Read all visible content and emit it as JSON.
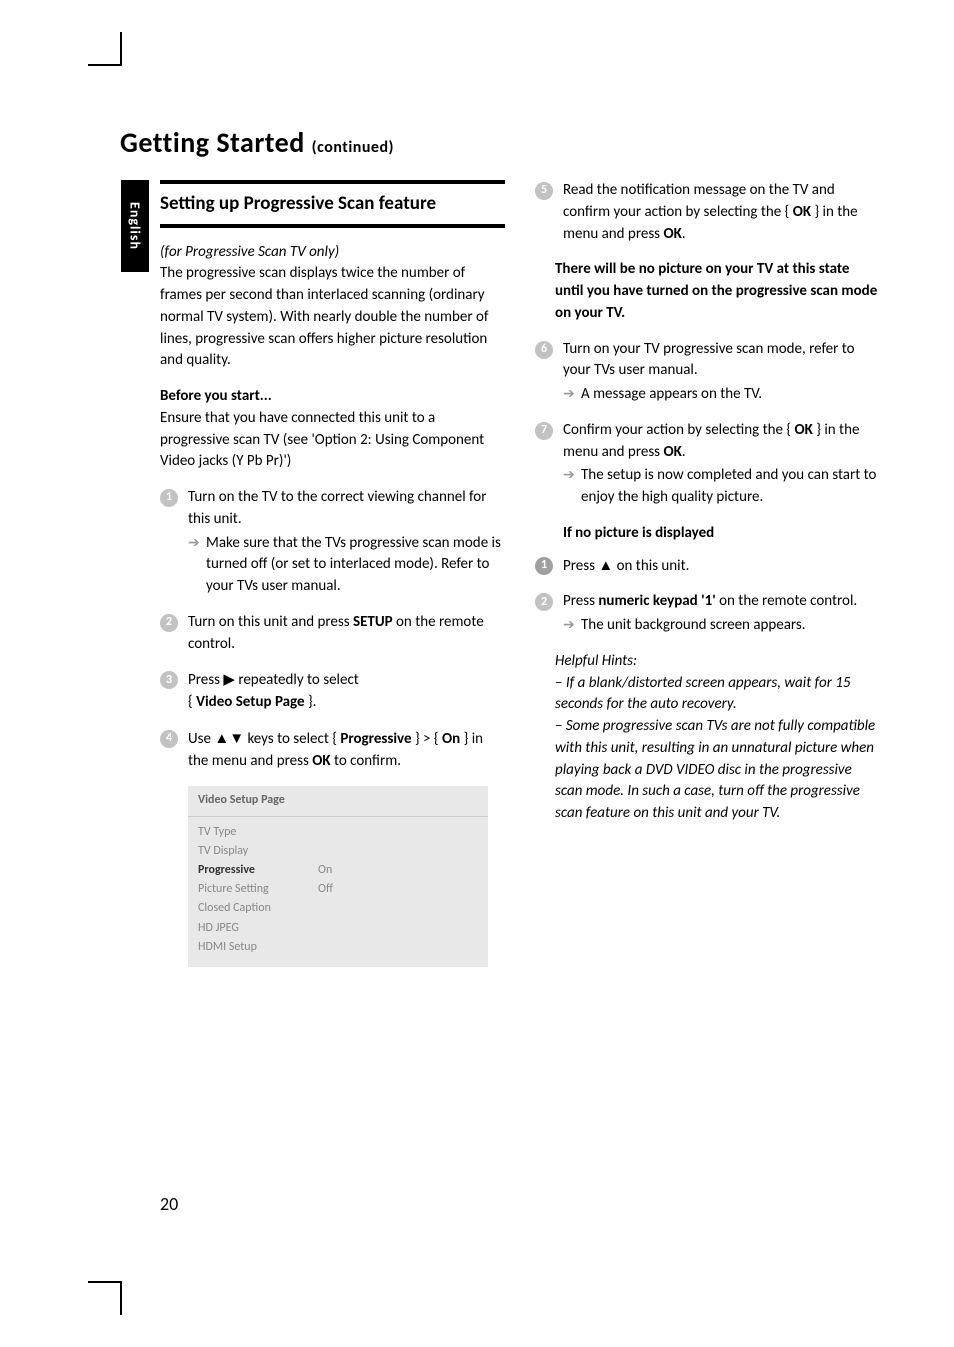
{
  "page": {
    "number": "20",
    "title_main": "Getting Started",
    "title_cont": "(continued)",
    "lang_tab": "English"
  },
  "left": {
    "heading": "Setting up Progressive Scan feature",
    "note_italic": "(for Progressive Scan TV only)",
    "intro": "The progressive scan displays twice the number of frames per second than interlaced scanning (ordinary normal TV system). With nearly double the number of lines, progressive scan offers higher picture resolution and quality.",
    "before_heading": "Before you start...",
    "before_body": "Ensure that you have connected this unit to a progressive scan TV (see 'Option 2: Using Component Video jacks (Y Pb Pr)')",
    "s1a": "Turn on the TV to the correct viewing channel for this unit.",
    "s1b": "Make sure that the TVs progressive scan mode is turned off (or set to interlaced mode). Refer to your TVs user manual.",
    "s2a": "Turn on this unit and press ",
    "s2b": "SETUP",
    "s2c": " on the remote control.",
    "s3a": "Press ",
    "s3b": " repeatedly to select",
    "s3c": "Video Setup Page",
    "s4a": "Use ",
    "s4b": " keys to select { ",
    "s4c": "Progressive",
    "s4d": " } > { ",
    "s4e": "On",
    "s4f": " } in the menu and press ",
    "s4g": "OK",
    "s4h": " to confirm."
  },
  "menu": {
    "title": "Video Setup Page",
    "r1": "TV Type",
    "r2": "TV Display",
    "r3l": "Progressive",
    "r3v": "On",
    "r4l": "Picture Setting",
    "r4v": "Off",
    "r5": "Closed Caption",
    "r6": "HD JPEG",
    "r7": "HDMI Setup"
  },
  "right": {
    "s5a": "Read the notification message on the TV and confirm your action by selecting the { ",
    "s5b": "OK",
    "s5c": " } in the menu and press ",
    "s5d": "OK",
    "s5e": ".",
    "warn": "There will be no picture on your TV at this state until you have turned on the progressive scan mode on your TV.",
    "s6a": "Turn on your TV progressive scan mode, refer to your TVs user manual.",
    "s6b": "A message appears on the TV.",
    "s7a": "Confirm your action by selecting the { ",
    "s7b": "OK",
    "s7c": " } in the menu and press ",
    "s7d": "OK",
    "s7e": ".",
    "s7f": "The setup is now completed and you can start to enjoy the high quality picture.",
    "no_pic_heading": "If no picture is displayed",
    "np1a": "Press ",
    "np1b": " on this unit.",
    "np2a": "Press ",
    "np2b": "numeric keypad '1'",
    "np2c": " on the remote control.",
    "np2d": "The unit background screen appears.",
    "hints_title": "Helpful Hints:",
    "hint1": "–  If a blank/distorted screen appears, wait for 15 seconds for the auto recovery.",
    "hint2": "–  Some progressive scan TVs are not fully compatible with this unit, resulting in an unnatural picture when playing back a DVD VIDEO disc in the progressive scan mode. In such a case, turn off the progressive scan feature on this unit and your TV."
  }
}
